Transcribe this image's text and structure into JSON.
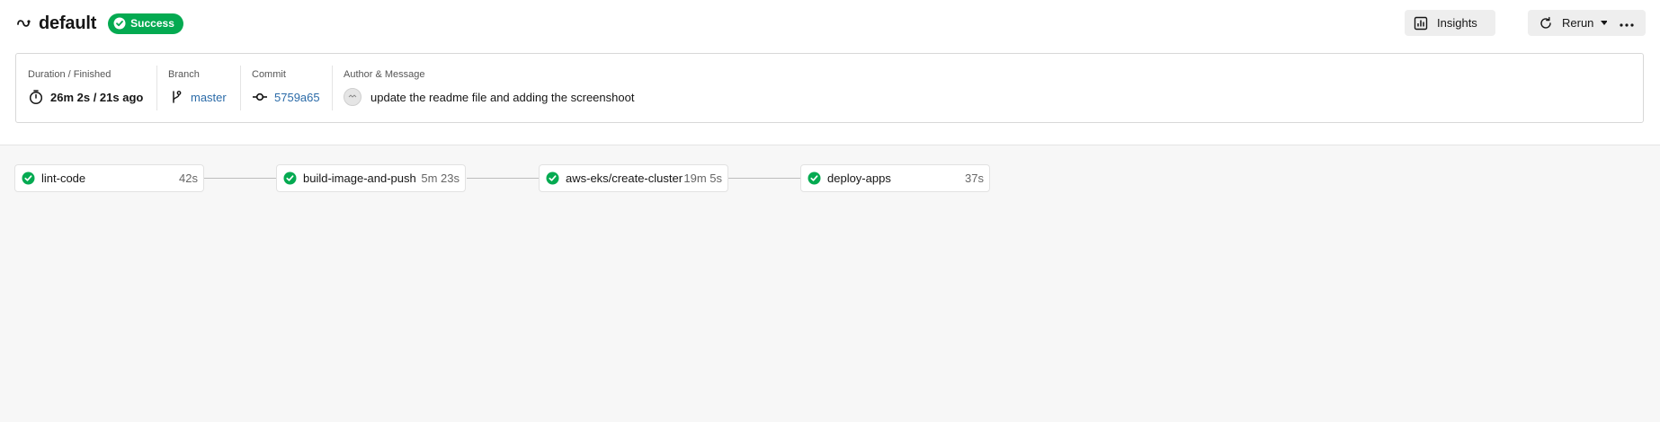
{
  "workflow": {
    "icon": "workflow-icon",
    "name": "default",
    "status": "Success",
    "status_color": "#04aa51"
  },
  "actions": {
    "insights_label": "Insights",
    "rerun_label": "Rerun"
  },
  "summary": {
    "duration_label": "Duration / Finished",
    "duration_value": "26m 2s / 21s ago",
    "branch_label": "Branch",
    "branch_value": "master",
    "commit_label": "Commit",
    "commit_value": "5759a65",
    "author_label": "Author & Message",
    "commit_message": "update the readme file and adding the screenshoot"
  },
  "jobs": [
    {
      "name": "lint-code",
      "duration": "42s"
    },
    {
      "name": "build-image-and-push",
      "duration": "5m 23s"
    },
    {
      "name": "aws-eks/create-cluster",
      "duration": "19m 5s"
    },
    {
      "name": "deploy-apps",
      "duration": "37s"
    }
  ],
  "colors": {
    "success": "#04aa51",
    "link": "#2b6ba8"
  }
}
